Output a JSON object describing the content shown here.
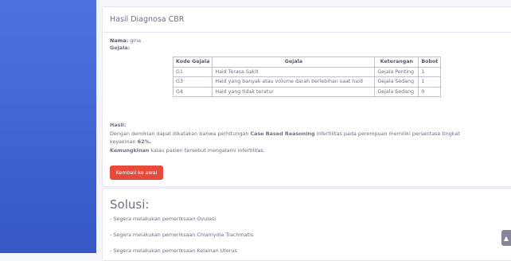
{
  "card1": {
    "title": "Hasil Diagnosa CBR",
    "nama_label": "Nama:",
    "nama_value": "gina",
    "gejala_label": "Gejala:",
    "table": {
      "headers": [
        "Kode Gejala",
        "Gejala",
        "Keterangan",
        "Bobot"
      ],
      "rows": [
        [
          "G1",
          "Haid Terasa Sakit",
          "Gejala Penting",
          "1"
        ],
        [
          "G3",
          "Haid yang banyak atau volume darah berlebihan saat haid",
          "Gejala Sedang",
          "1"
        ],
        [
          "G4",
          "Haid yang tidak teratur",
          "Gejala Sedang",
          "0"
        ]
      ]
    },
    "hasil_label": "Hasil:",
    "hasil_line1_a": "Dengan demikian dapat dikatakan bahwa perhitungan ",
    "hasil_line1_b": "Case Based Reasoning",
    "hasil_line1_c": " infertilitas pada perempuan memiliki persentase tingkat",
    "hasil_line2_a": "keyakinan ",
    "hasil_line2_b": "62%.",
    "kemungkinan_a": "Kemungkinan",
    "kemungkinan_b": " kalau pasien tersebut mengalami infertilitas.",
    "button_label": "Kembali ke awal"
  },
  "card2": {
    "title": "Solusi:",
    "items": [
      "- Segera melakukan pemeriksaan Ovulasi",
      "- Segera melakukan pemeriksaan Chlamydia Trachmatis",
      "- Segera melakukan pemeriksaan Kelainan Uterus"
    ]
  },
  "colors": {
    "sidebar": "#4e73df",
    "button": "#e74a3b",
    "background": "#f4f6f9"
  },
  "scroll_top_icon": "chevron-up-icon"
}
